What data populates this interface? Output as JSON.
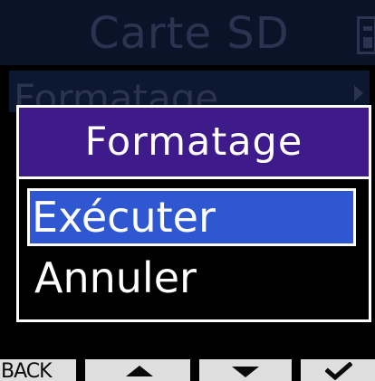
{
  "header": {
    "title": "Carte SD",
    "battery_icon": "battery-icon"
  },
  "menu": {
    "item_label": "Formatage",
    "arrow_icon": "chevron-right-icon"
  },
  "dialog": {
    "title": "Formatage",
    "options": [
      {
        "label": "Exécuter",
        "selected": true
      },
      {
        "label": "Annuler",
        "selected": false
      }
    ]
  },
  "softkeys": {
    "back_label": "BACK",
    "up_icon": "arrow-up-icon",
    "down_icon": "arrow-down-icon",
    "confirm_icon": "check-icon"
  },
  "colors": {
    "background": "#000000",
    "header_band": "#0a1428",
    "dim_text": "#2c3350",
    "dialog_header": "#3e1a8a",
    "selection": "#2f57d2",
    "softkey_bg": "#dedede",
    "text": "#ffffff"
  }
}
